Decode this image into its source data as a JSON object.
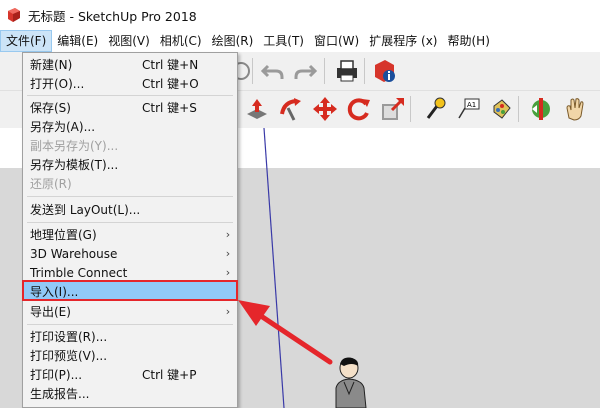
{
  "window": {
    "title": "无标题 - SketchUp Pro 2018"
  },
  "menubar": {
    "items": [
      {
        "label": "文件(F)"
      },
      {
        "label": "编辑(E)"
      },
      {
        "label": "视图(V)"
      },
      {
        "label": "相机(C)"
      },
      {
        "label": "绘图(R)"
      },
      {
        "label": "工具(T)"
      },
      {
        "label": "窗口(W)"
      },
      {
        "label": "扩展程序 (x)"
      },
      {
        "label": "帮助(H)"
      }
    ]
  },
  "file_menu": {
    "items": [
      {
        "label": "新建(N)",
        "shortcut": "Ctrl 键+N"
      },
      {
        "label": "打开(O)...",
        "shortcut": "Ctrl 键+O"
      },
      {
        "label": "保存(S)",
        "shortcut": "Ctrl 键+S"
      },
      {
        "label": "另存为(A)..."
      },
      {
        "label": "副本另存为(Y)...",
        "disabled": true
      },
      {
        "label": "另存为模板(T)..."
      },
      {
        "label": "还原(R)",
        "disabled": true
      },
      {
        "label": "发送到 LayOut(L)..."
      },
      {
        "label": "地理位置(G)",
        "submenu": true
      },
      {
        "label": "3D Warehouse",
        "submenu": true
      },
      {
        "label": "Trimble Connect",
        "submenu": true
      },
      {
        "label": "导入(I)...",
        "highlighted": true
      },
      {
        "label": "导出(E)",
        "submenu": true
      },
      {
        "label": "打印设置(R)..."
      },
      {
        "label": "打印预览(V)..."
      },
      {
        "label": "打印(P)...",
        "shortcut": "Ctrl 键+P"
      },
      {
        "label": "生成报告..."
      }
    ]
  },
  "colors": {
    "highlight": "#91c9f7",
    "annotation_red": "#e5262b",
    "ground": "#d8d8d8",
    "menu_bg": "#f2f2f2"
  },
  "icons": [
    "sketchup-app-icon",
    "undo-icon",
    "redo-icon",
    "print-icon",
    "model-info-icon",
    "push-pull-icon",
    "follow-me-icon",
    "move-icon",
    "rotate-icon",
    "scale-icon",
    "tape-measure-icon",
    "text-icon",
    "paint-bucket-icon",
    "section-plane-icon",
    "orbit-icon",
    "pan-hand-icon"
  ]
}
